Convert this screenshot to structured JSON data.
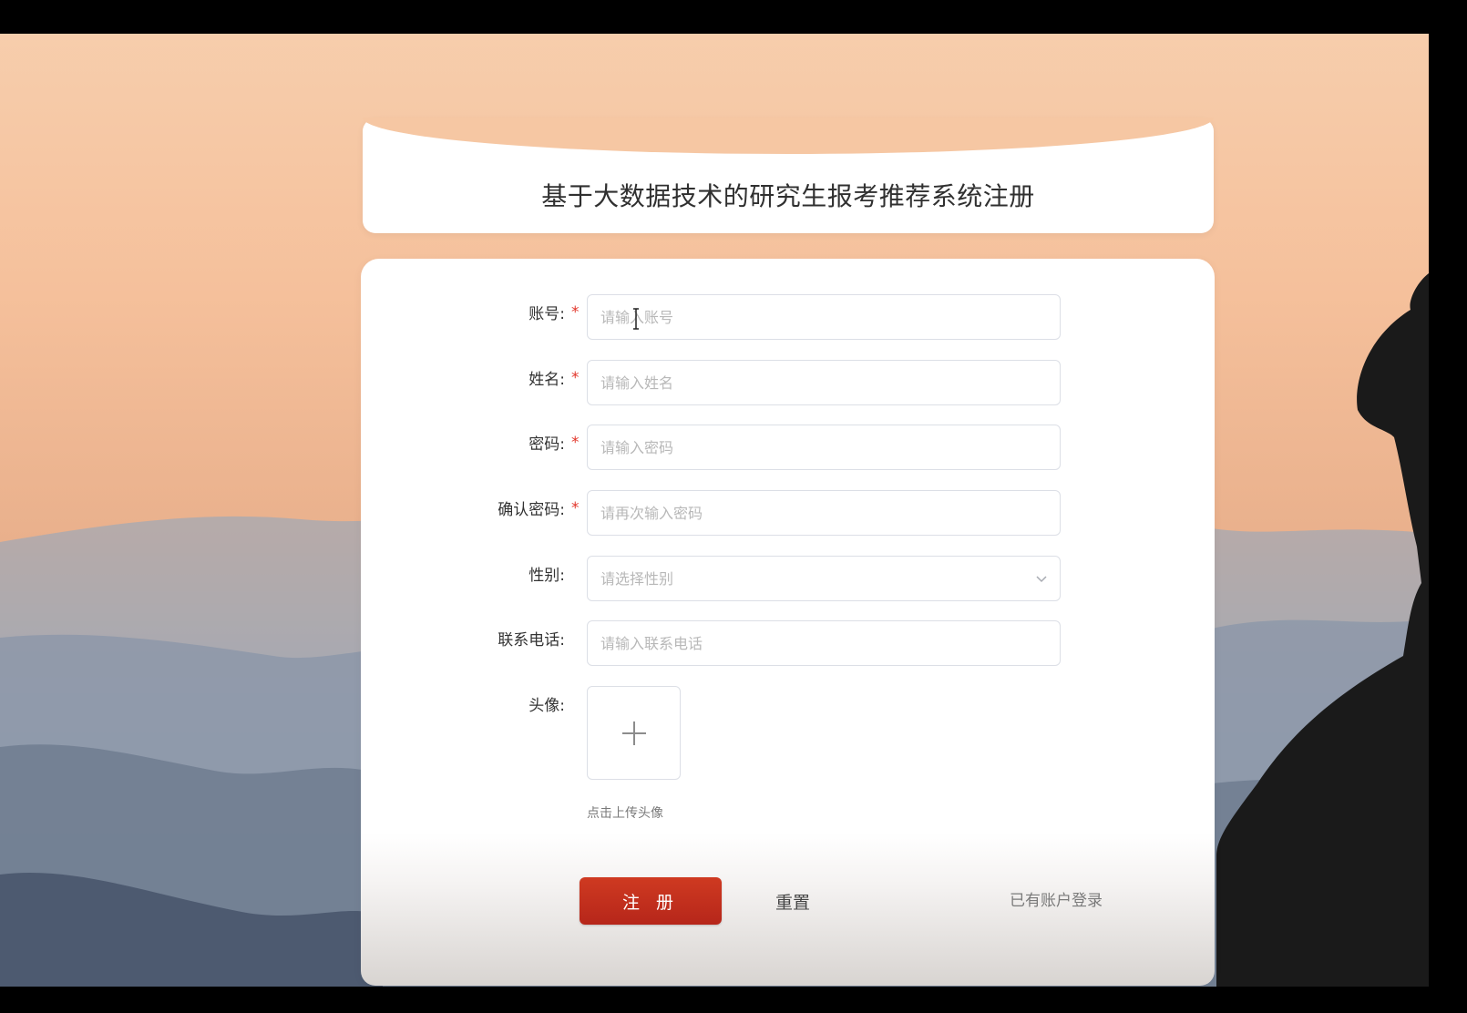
{
  "page": {
    "title": "基于大数据技术的研究生报考推荐系统注册"
  },
  "form": {
    "account": {
      "label": "账号:",
      "required_mark": "*",
      "placeholder": "请输入账号"
    },
    "name": {
      "label": "姓名:",
      "required_mark": "*",
      "placeholder": "请输入姓名"
    },
    "password": {
      "label": "密码:",
      "required_mark": "*",
      "placeholder": "请输入密码"
    },
    "confirm_password": {
      "label": "确认密码:",
      "required_mark": "*",
      "placeholder": "请再次输入密码"
    },
    "gender": {
      "label": "性别:",
      "placeholder": "请选择性别"
    },
    "phone": {
      "label": "联系电话:",
      "placeholder": "请输入联系电话"
    },
    "avatar": {
      "label": "头像:",
      "hint": "点击上传头像"
    }
  },
  "actions": {
    "register_label": "注 册",
    "reset_label": "重置",
    "login_link": "已有账户登录"
  },
  "colors": {
    "primary": "#c2301d",
    "required": "#e2352a",
    "border": "#dcdfe6"
  }
}
